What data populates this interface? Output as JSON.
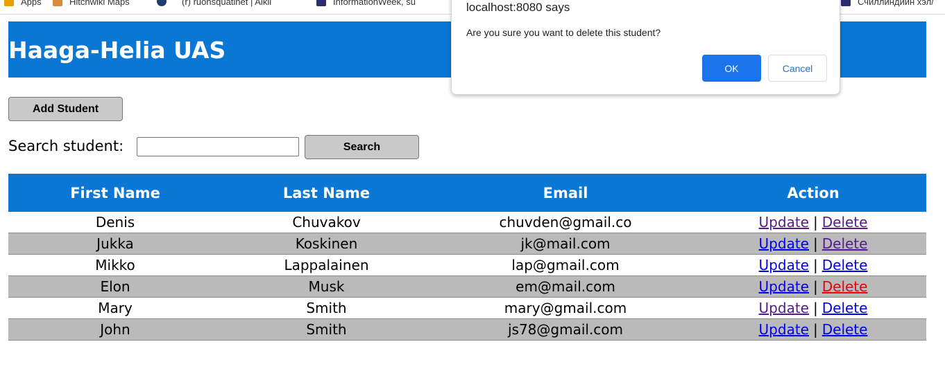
{
  "bookmarks": [
    {
      "label": "Apps",
      "icon": "apps-icon",
      "color": "#e8a100"
    },
    {
      "label": "Hitchwiki Maps",
      "icon": "thumb-icon",
      "color": "#d98c3e"
    },
    {
      "label": "",
      "icon": "globe-icon",
      "color": "#1d3b6e"
    },
    {
      "label": "(r) ruonsquatinet | Aikli",
      "icon": "radio-icon",
      "color": "#555555"
    },
    {
      "label": "InformationWeek, su",
      "icon": "iw-icon",
      "color": "#2b2d6e"
    },
    {
      "label": "Счиллиндийн хэл/",
      "icon": "book-icon",
      "color": "#2b2d6e"
    }
  ],
  "header": {
    "title": "Haaga-Helia UAS"
  },
  "actions": {
    "add_label": "Add Student"
  },
  "search": {
    "label": "Search student:",
    "value": "",
    "placeholder": "",
    "button_label": "Search"
  },
  "table": {
    "headers": [
      "First Name",
      "Last Name",
      "Email",
      "Action"
    ],
    "update_label": "Update",
    "delete_label": "Delete",
    "separator": "|",
    "rows": [
      {
        "first": "Denis",
        "last": "Chuvakov",
        "email": "chuvden@gmail.co"
      },
      {
        "first": "Jukka",
        "last": "Koskinen",
        "email": "jk@mail.com"
      },
      {
        "first": "Mikko",
        "last": "Lappalainen",
        "email": "lap@gmail.com"
      },
      {
        "first": "Elon",
        "last": "Musk",
        "email": "em@mail.com"
      },
      {
        "first": "Mary",
        "last": "Smith",
        "email": "mary@gmail.com"
      },
      {
        "first": "John",
        "last": "Smith",
        "email": "js78@gmail.com"
      }
    ]
  },
  "dialog": {
    "title": "localhost:8080 says",
    "message": "Are you sure you want to delete this student?",
    "ok_label": "OK",
    "cancel_label": "Cancel"
  },
  "colors": {
    "header_bg": "#0a77d5",
    "row_alt_bg": "#bababa",
    "link": "#0000ee",
    "link_visited": "#551a8b",
    "link_active": "#ee0000",
    "dialog_ok_bg": "#1a73e8"
  }
}
